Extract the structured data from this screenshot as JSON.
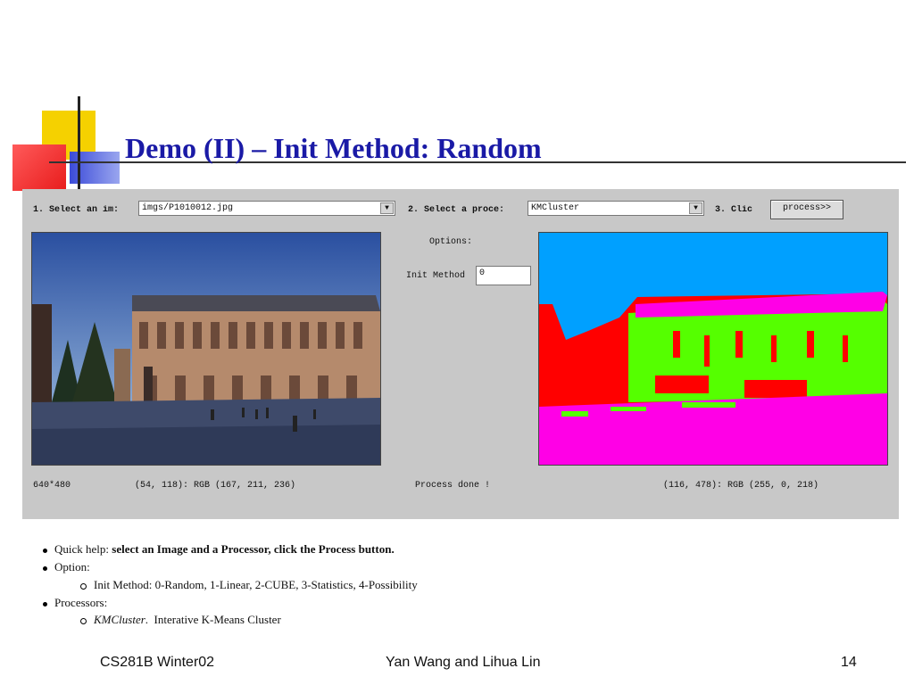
{
  "slide": {
    "title": "Demo (II) – Init Method: Random"
  },
  "applet": {
    "step1_label": "1. Select an im:",
    "image_select_value": "imgs/P1010012.jpg",
    "step2_label": "2. Select a proce:",
    "processor_select_value": "KMCluster",
    "step3_label": "3. Clic",
    "process_button_label": "process>>",
    "options_label": "Options:",
    "init_method_label": "Init Method",
    "init_method_value": "0",
    "image_size": "640*480",
    "source_pixel_info": "(54, 118): RGB (167, 211, 236)",
    "status_text": "Process done !",
    "result_pixel_info": "(116, 478): RGB (255, 0, 218)"
  },
  "help": {
    "quick_help_prefix": "Quick help: ",
    "quick_help_bold": "select an Image and a Processor, click the Process button.",
    "option_label": "Option:",
    "init_method_desc": "Init Method: 0-Random, 1-Linear, 2-CUBE, 3-Statistics, 4-Possibility",
    "processors_label": "Processors:",
    "processor_name": "KMCluster",
    "processor_desc": "Interative K-Means Cluster"
  },
  "footer": {
    "course": "CS281B Winter02",
    "authors": "Yan Wang and Lihua Lin",
    "page_number": "14"
  },
  "colors": {
    "title": "#1a1aa6",
    "applet_bg": "#c8c8c8",
    "cluster_sky": "#00a0ff",
    "cluster_building": "#55ff00",
    "cluster_dark": "#ff0000",
    "cluster_ground": "#ff00e6"
  }
}
